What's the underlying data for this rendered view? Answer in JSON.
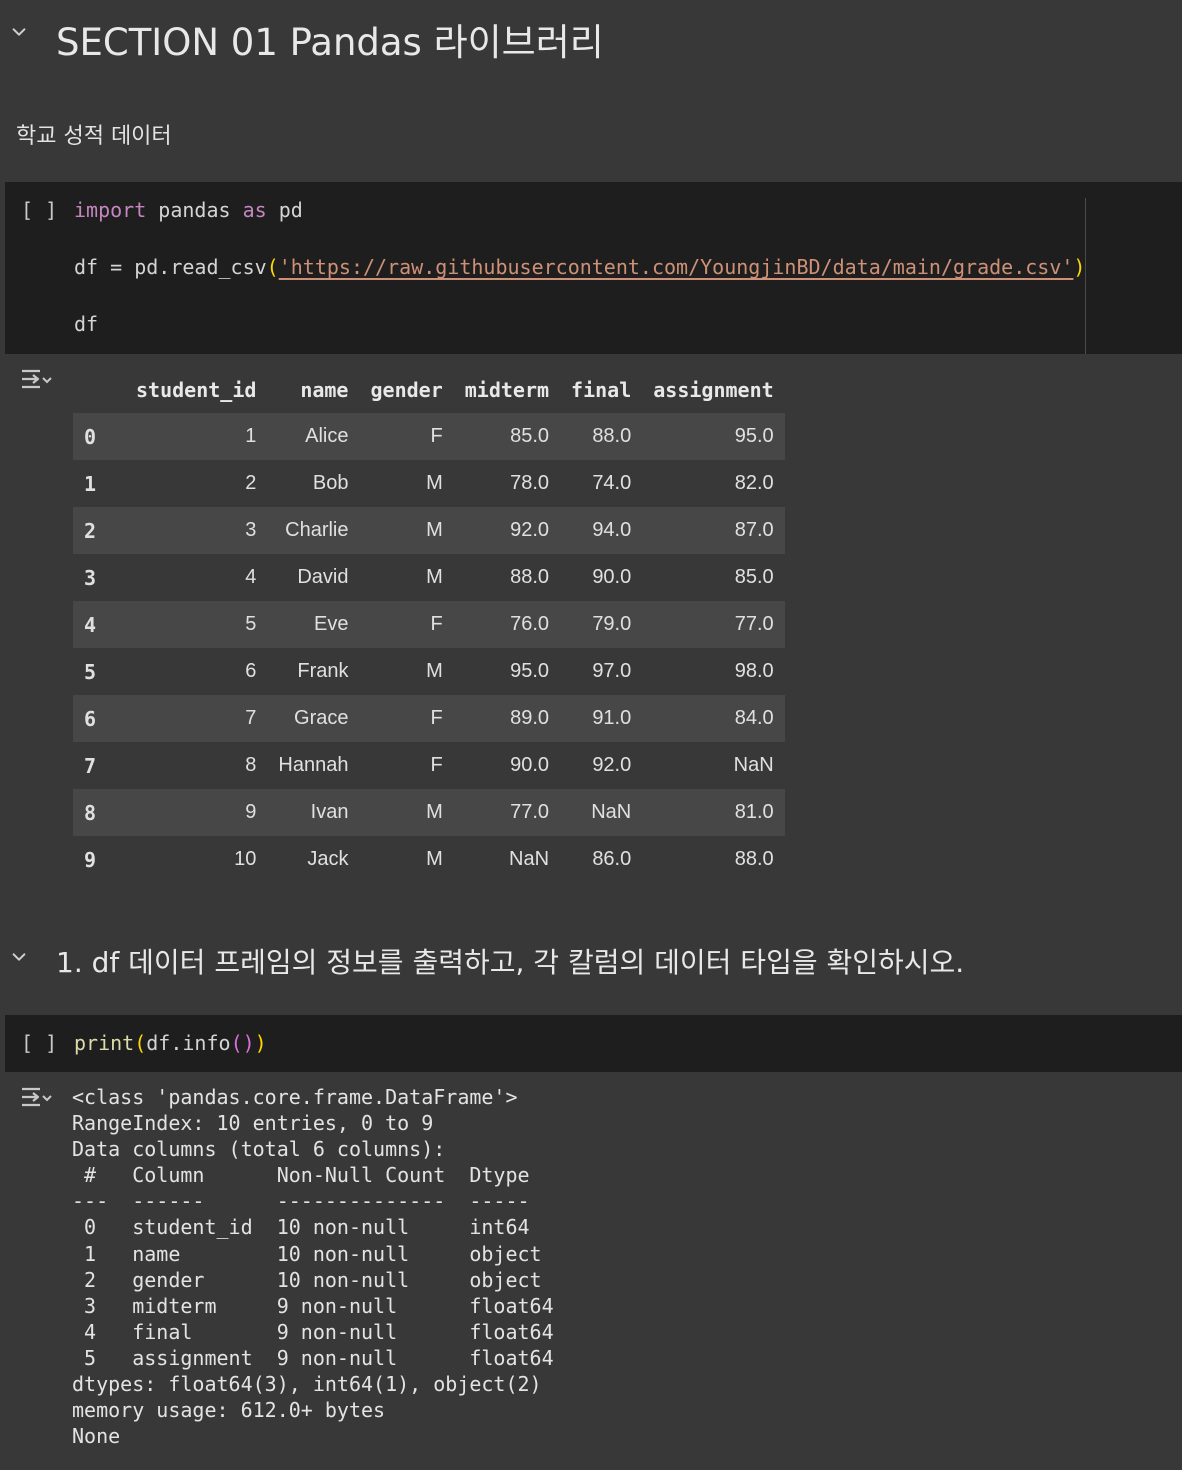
{
  "section_heading": "SECTION 01 Pandas 라이브러리",
  "subtitle": "학교 성적 데이터",
  "cell1": {
    "run_indicator": "[ ]",
    "code": {
      "line1_kw1": "import",
      "line1_mid": " pandas ",
      "line1_kw2": "as",
      "line1_end": " pd",
      "line2_prefix": "df = pd.read_csv",
      "line2_open": "(",
      "line2_str": "'https://raw.githubusercontent.com/YoungjinBD/data/main/grade.csv'",
      "line2_close": ")",
      "line3": "df"
    }
  },
  "dataframe": {
    "columns": [
      "",
      "student_id",
      "name",
      "gender",
      "midterm",
      "final",
      "assignment"
    ],
    "rows": [
      [
        "0",
        "1",
        "Alice",
        "F",
        "85.0",
        "88.0",
        "95.0"
      ],
      [
        "1",
        "2",
        "Bob",
        "M",
        "78.0",
        "74.0",
        "82.0"
      ],
      [
        "2",
        "3",
        "Charlie",
        "M",
        "92.0",
        "94.0",
        "87.0"
      ],
      [
        "3",
        "4",
        "David",
        "M",
        "88.0",
        "90.0",
        "85.0"
      ],
      [
        "4",
        "5",
        "Eve",
        "F",
        "76.0",
        "79.0",
        "77.0"
      ],
      [
        "5",
        "6",
        "Frank",
        "M",
        "95.0",
        "97.0",
        "98.0"
      ],
      [
        "6",
        "7",
        "Grace",
        "F",
        "89.0",
        "91.0",
        "84.0"
      ],
      [
        "7",
        "8",
        "Hannah",
        "F",
        "90.0",
        "92.0",
        "NaN"
      ],
      [
        "8",
        "9",
        "Ivan",
        "M",
        "77.0",
        "NaN",
        "81.0"
      ],
      [
        "9",
        "10",
        "Jack",
        "M",
        "NaN",
        "86.0",
        "88.0"
      ]
    ]
  },
  "question_heading": "1. df 데이터 프레임의 정보를 출력하고, 각 칼럼의 데이터 타입을 확인하시오.",
  "cell2": {
    "run_indicator": "[ ]",
    "code": {
      "fn": "print",
      "open": "(",
      "mid": "df.info",
      "inner": "()",
      "close": ")"
    }
  },
  "info_output": "<class 'pandas.core.frame.DataFrame'>\nRangeIndex: 10 entries, 0 to 9\nData columns (total 6 columns):\n #   Column      Non-Null Count  Dtype  \n---  ------      --------------  -----  \n 0   student_id  10 non-null     int64  \n 1   name        10 non-null     object \n 2   gender      10 non-null     object \n 3   midterm     9 non-null      float64\n 4   final       9 non-null      float64\n 5   assignment  9 non-null      float64\ndtypes: float64(3), int64(1), object(2)\nmemory usage: 612.0+ bytes\nNone",
  "icons": {
    "collapse": "chevron-down-icon",
    "output": "output-toggle-icon"
  }
}
